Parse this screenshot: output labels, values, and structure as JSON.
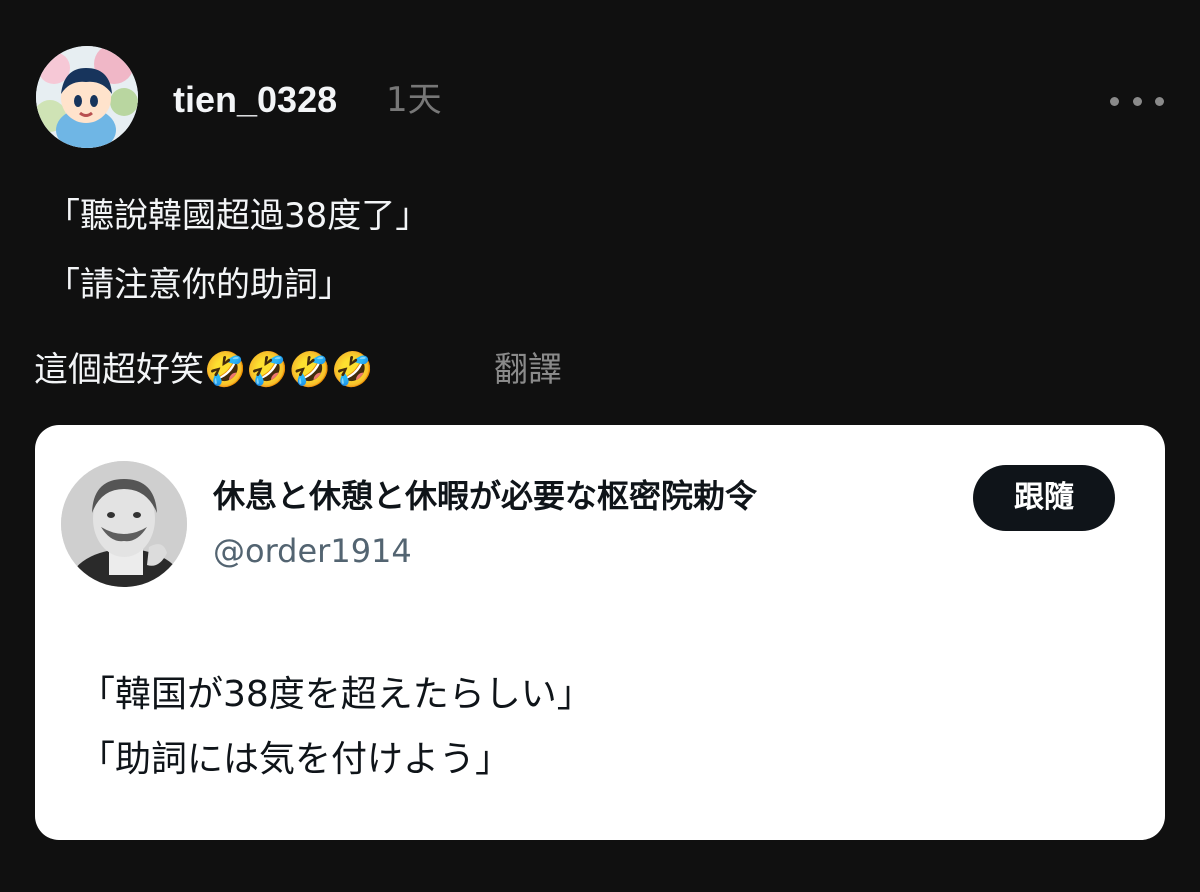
{
  "post": {
    "username": "tien_0328",
    "time": "1天",
    "lines": [
      "「聽說韓國超過38度了」",
      "「請注意你的助詞」",
      "這個超好笑🤣🤣🤣🤣"
    ],
    "translate_label": "翻譯"
  },
  "embed": {
    "display_name": "休息と休憩と休暇が必要な枢密院勅令",
    "handle": "@order1914",
    "follow_label": "跟隨",
    "lines": [
      "「韓国が38度を超えたらしい」",
      "「助詞には気を付けよう」"
    ]
  },
  "icons": {
    "more": "more-horizontal-icon",
    "laugh": "rolling-on-floor-laughing-emoji"
  },
  "colors": {
    "background": "#101010",
    "text": "#f3f5f7",
    "muted": "#777777",
    "card_background": "#ffffff",
    "card_text": "#0f1419",
    "card_muted": "#536471",
    "button_background": "#0f1419"
  }
}
